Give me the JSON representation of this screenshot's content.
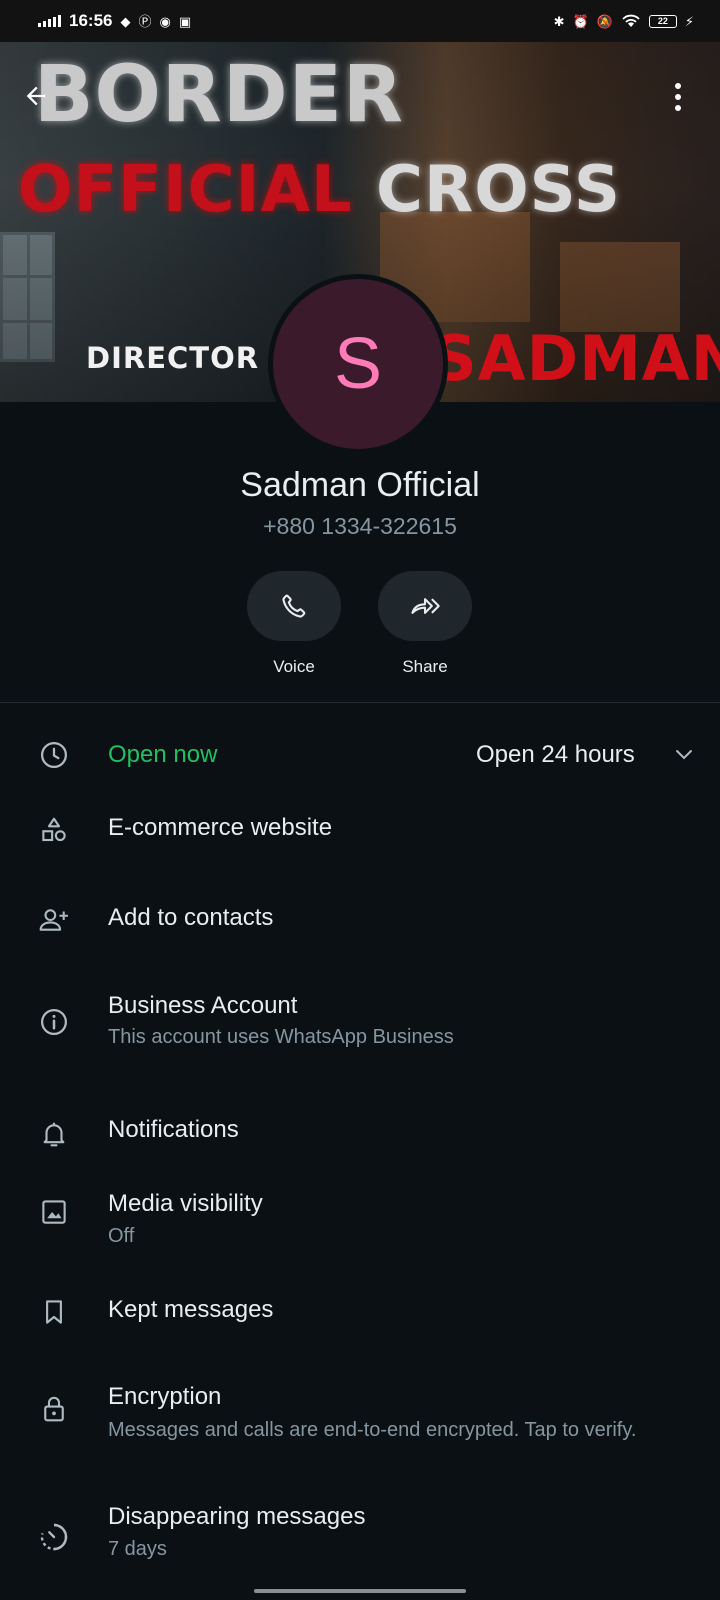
{
  "status_bar": {
    "time": "16:56",
    "battery": "22"
  },
  "cover": {
    "line1": "BORDER",
    "line2a": "OFFICIAL",
    "line2b": "CROSS",
    "line3a": "DIRECTOR",
    "line3b": "SADMAN"
  },
  "profile": {
    "avatar_letter": "S",
    "avatar_color": "#3b1a2c",
    "avatar_letter_color": "#ff7bb8",
    "name": "Sadman Official",
    "phone": "+880 1334-322615"
  },
  "actions": [
    {
      "label": "Voice",
      "icon": "phone-icon"
    },
    {
      "label": "Share",
      "icon": "share-forward-icon"
    }
  ],
  "hours": {
    "status": "Open now",
    "hours": "Open 24 hours"
  },
  "info_rows": {
    "category": {
      "title": "E-commerce website",
      "icon": "shapes-icon"
    },
    "add_contact": {
      "title": "Add to contacts",
      "icon": "add-person-icon"
    },
    "business": {
      "title": "Business Account",
      "subtitle": "This account uses WhatsApp Business",
      "icon": "info-icon"
    },
    "notifications": {
      "title": "Notifications",
      "icon": "bell-icon"
    },
    "media": {
      "title": "Media visibility",
      "subtitle": "Off",
      "icon": "image-icon"
    },
    "kept": {
      "title": "Kept messages",
      "icon": "bookmark-icon"
    },
    "encryption": {
      "title": "Encryption",
      "subtitle": "Messages and calls are end-to-end encrypted. Tap to verify.",
      "icon": "lock-icon"
    },
    "disappearing": {
      "title": "Disappearing messages",
      "subtitle": "7 days",
      "icon": "timer-icon"
    }
  },
  "colors": {
    "background": "#0b1014",
    "accent_green": "#21c063",
    "secondary_text": "#8696a0"
  }
}
